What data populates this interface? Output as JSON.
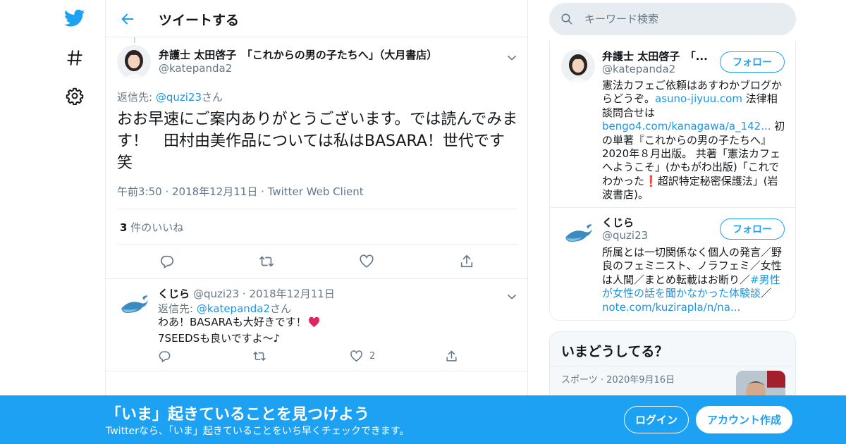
{
  "nav": {
    "icons": [
      "twitter-bird-icon",
      "hashtag-icon",
      "settings-gear-icon"
    ]
  },
  "header": {
    "title": "ツイートする"
  },
  "tweet": {
    "author_name": "弁護士 太田啓子　「これからの男の子たちへ」（大月書店）",
    "author_handle": "@katepanda2",
    "reply_prefix": "返信先: ",
    "reply_handle": "@quzi23",
    "reply_suffix": "さん",
    "text": "おお早速にご案内ありがとうございます。では読んでみます！　田村由美作品については私はBASARA！世代です笑",
    "time": "午前3:50",
    "date": "2018年12月11日",
    "client": "Twitter Web Client",
    "likes_count": "3",
    "likes_label": "件のいいね"
  },
  "reply": {
    "author_name": "くじら",
    "author_handle": "@quzi23",
    "date": "2018年12月11日",
    "reply_prefix": "返信先: ",
    "reply_handle": "@katepanda2",
    "reply_suffix": "さん",
    "line1": "わあ！BASARAも大好きです！",
    "line2": "7SEEDSも良いですよ〜♪",
    "likes_count": "2"
  },
  "search": {
    "placeholder": "キーワード検索"
  },
  "profiles": [
    {
      "name": "弁護士 太田啓子　「...",
      "handle": "@katepanda2",
      "follow_label": "フォロー",
      "bio_1": "憲法カフェご依頼はあすわかブログからどうぞ。",
      "bio_link_1": "asuno-jiyuu.com",
      "bio_2": " 法律相談問合せは",
      "bio_link_2": "bengo4.com/kanagawa/a_142...",
      "bio_3": " 初の単著『これからの男の子たちへ』2020年８月出版。 共著「憲法カフェへようこそ」(かもがわ出版)「これでわかった",
      "bio_emoji": "❗",
      "bio_4": "超訳特定秘密保護法」(岩波書店)。"
    },
    {
      "name": "くじら",
      "handle": "@quzi23",
      "follow_label": "フォロー",
      "bio_1": "所属とは一切関係なく個人の発言／野良のフェミニスト、ノラフェミ／女性は人間／まとめ転載はお断り／",
      "bio_link_1": "#男性が女性の話を聞かなかった体験談",
      "bio_2": "／",
      "bio_link_2": "note.com/kuzirapla/n/na..."
    }
  ],
  "trends": {
    "title": "いまどうしてる？",
    "items": [
      {
        "category": "スポーツ",
        "date": "2020年9月16日"
      }
    ]
  },
  "banner": {
    "title": "「いま」起きていることを見つけよう",
    "subtitle": "Twitterなら、「いま」起きていることをいち早くチェックできます。",
    "login_label": "ログイン",
    "signup_label": "アカウント作成"
  },
  "colors": {
    "brand": "#1da1f2",
    "link": "#1b95e0",
    "secondary_text": "#657786",
    "border": "#e6ecf0",
    "heart": "#e0245e"
  }
}
